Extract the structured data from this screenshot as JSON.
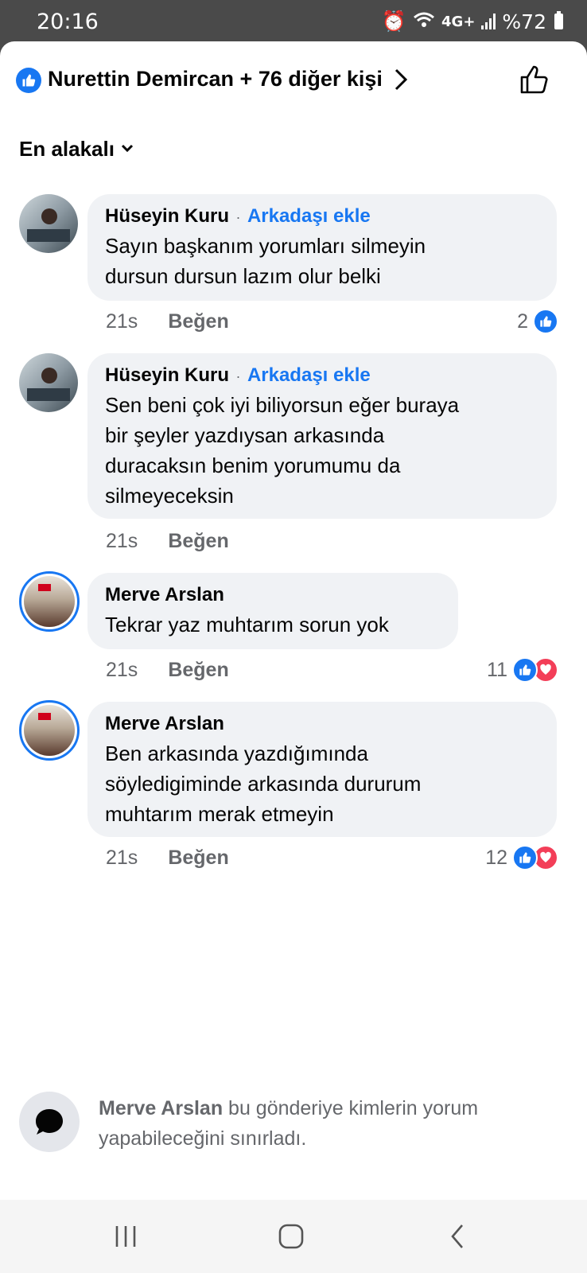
{
  "status_bar": {
    "time": "20:16",
    "network_label": "4G+",
    "battery": "%72"
  },
  "header": {
    "title": "Nurettin Demircan + 76 diğer kişi",
    "icons": [
      "like-badge-icon",
      "chevron-right-icon",
      "thumbs-up-outline-icon"
    ]
  },
  "sort": {
    "label": "En alakalı"
  },
  "comments": [
    {
      "author": "Hüseyin Kuru",
      "action": "Arkadaşı ekle",
      "lines": [
        "Sayın başkanım yorumları silmeyin",
        "dursun dursun lazım olur belki"
      ],
      "time": "21s",
      "like_label": "Beğen",
      "reaction_count": "2",
      "reactions": [
        "like"
      ]
    },
    {
      "author": "Hüseyin Kuru",
      "action": "Arkadaşı ekle",
      "lines": [
        "Sen beni çok iyi biliyorsun eğer buraya",
        "bir şeyler yazdıysan arkasında",
        "duracaksın benim yorumumu da",
        "silmeyeceksin"
      ],
      "time": "21s",
      "like_label": "Beğen",
      "reaction_count": "",
      "reactions": []
    },
    {
      "author": "Merve Arslan",
      "action": "",
      "lines": [
        "Tekrar yaz muhtarım sorun yok"
      ],
      "time": "21s",
      "like_label": "Beğen",
      "reaction_count": "11",
      "reactions": [
        "like",
        "love"
      ]
    },
    {
      "author": "Merve Arslan",
      "action": "",
      "lines": [
        "Ben arkasında yazdığımında",
        "söyledigiminde arkasında dururum",
        "muhtarım merak etmeyin"
      ],
      "time": "21s",
      "like_label": "Beğen",
      "reaction_count": "12",
      "reactions": [
        "like",
        "love"
      ]
    }
  ],
  "notice": {
    "name": "Merve Arslan",
    "text": " bu gönderiye kimlerin yorum yapabileceğini sınırladı."
  },
  "colors": {
    "brand_blue": "#1877f2",
    "love_red": "#f33e58",
    "bubble_bg": "#f0f2f5",
    "secondary_text": "#65676b"
  }
}
